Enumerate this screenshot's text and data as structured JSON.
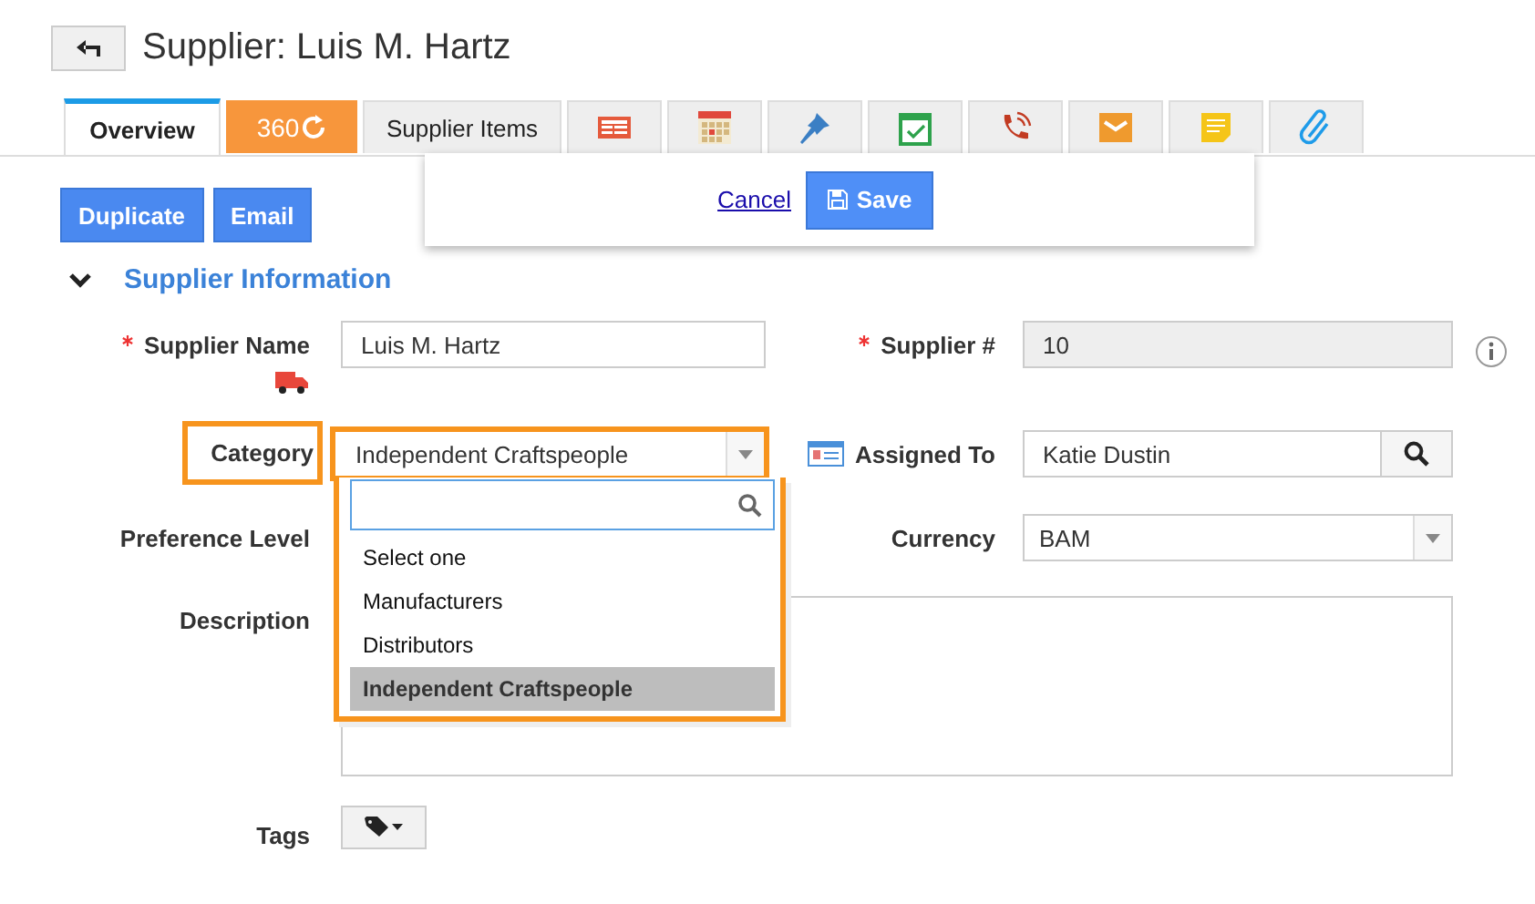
{
  "header": {
    "title": "Supplier: Luis M. Hartz"
  },
  "tabs": [
    {
      "kind": "text",
      "label": "Overview",
      "selected": true
    },
    {
      "kind": "badge",
      "label": "360",
      "selected": false
    },
    {
      "kind": "text",
      "label": "Supplier Items",
      "selected": false
    },
    {
      "kind": "icon",
      "selected": false
    },
    {
      "kind": "icon",
      "selected": false
    },
    {
      "kind": "icon",
      "selected": false
    },
    {
      "kind": "icon",
      "selected": false
    },
    {
      "kind": "icon",
      "selected": false
    },
    {
      "kind": "icon",
      "selected": false
    },
    {
      "kind": "icon",
      "selected": false
    },
    {
      "kind": "icon",
      "selected": false
    }
  ],
  "actions": [
    "Duplicate",
    "Email"
  ],
  "save_bar": {
    "cancel": "Cancel",
    "save": "Save"
  },
  "section": {
    "title": "Supplier Information",
    "expanded": true
  },
  "supplier_name": {
    "label": "Supplier Name",
    "required": true,
    "value": "Luis M. Hartz"
  },
  "supplier_number": {
    "label": "Supplier #",
    "required": true,
    "value": "10",
    "readonly": true
  },
  "category": {
    "label": "Category",
    "value": "Independent Craftspeople",
    "highlighted": true,
    "expanded": true,
    "options": [
      {
        "label": "Select one",
        "selected": false
      },
      {
        "label": "Manufacturers",
        "selected": false
      },
      {
        "label": "Distributors",
        "selected": false
      },
      {
        "label": "Independent Craftspeople",
        "selected": true
      }
    ]
  },
  "assigned_to": {
    "label": "Assigned To",
    "value": "Katie Dustin"
  },
  "preference_level": {
    "label": "Preference Level"
  },
  "currency": {
    "label": "Currency",
    "value": "BAM"
  },
  "description": {
    "label": "Description"
  },
  "tags": {
    "label": "Tags"
  }
}
